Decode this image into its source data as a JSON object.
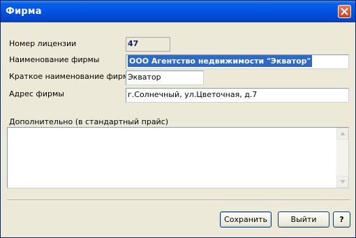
{
  "window": {
    "title": "Фирма",
    "close_icon": "close-icon"
  },
  "form": {
    "license": {
      "label": "Номер лицензии",
      "value": "47"
    },
    "firm_name": {
      "label": "Наименование фирмы",
      "value": "ООО Агентство недвижимости \"Экватор\""
    },
    "short_name": {
      "label": "Краткое наименование фирмы",
      "value": "Экватор"
    },
    "address": {
      "label": "Адрес фирмы",
      "value": "г.Солнечный, ул.Цветочная, д.7"
    },
    "extra": {
      "label": "Дополнительно (в стандартный прайс)",
      "value": ""
    }
  },
  "buttons": {
    "save": "Сохранить",
    "exit": "Выйти",
    "help": "?"
  },
  "colors": {
    "titlebar": "#0054e3",
    "selection": "#316ac5",
    "dialog_bg": "#ece9d8"
  }
}
